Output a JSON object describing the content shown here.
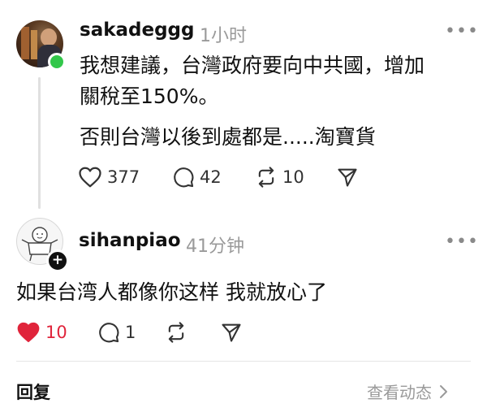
{
  "post1": {
    "username": "sakadeggg",
    "time": "1小时",
    "more": "•••",
    "line1": "我想建議，台灣政府要向中共國，增加",
    "line2": "關稅至150%。",
    "line3": "否則台灣以後到處都是.....淘寶貨",
    "likes": "377",
    "comments": "42",
    "reposts": "10"
  },
  "post2": {
    "username": "sihanpiao",
    "time": "41分钟",
    "more": "•••",
    "text": "如果台湾人都像你这样 我就放心了",
    "likes": "10",
    "comments": "1"
  },
  "footer": {
    "reply_label": "回复",
    "view_label": "查看动态"
  },
  "colors": {
    "like_active": "#e0243b",
    "online": "#32c74a",
    "muted": "#9a9a9a"
  }
}
